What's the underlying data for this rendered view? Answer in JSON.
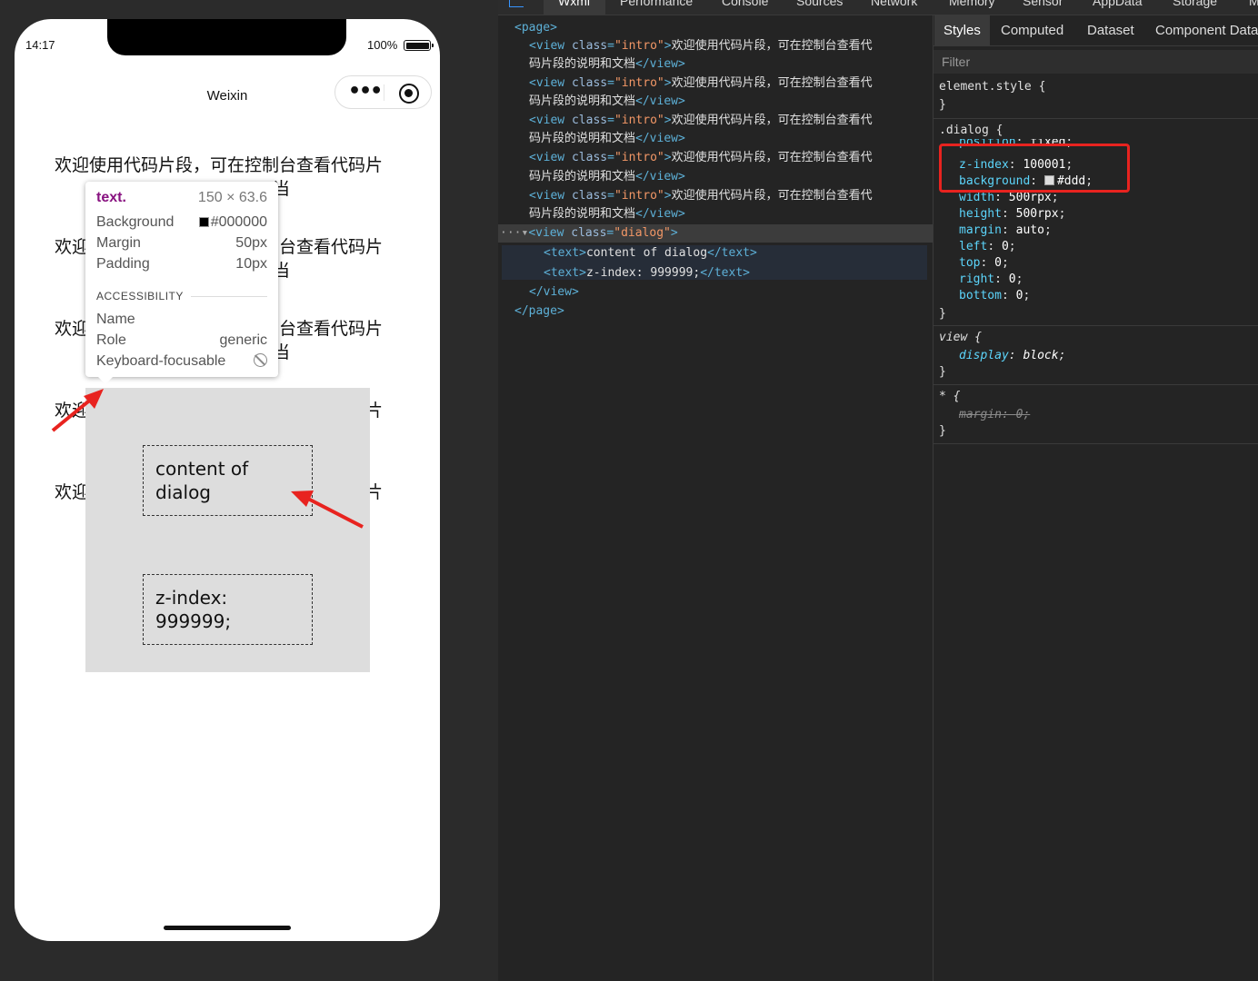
{
  "simulator": {
    "status_time": "14:17",
    "battery_percent": "100%",
    "nav_title": "Weixin",
    "capsule": {
      "more_icon": "more-dots-icon",
      "close_icon": "target-circle-icon"
    },
    "intro_line1": "欢迎使用代码片段，可在控制台查看代码片",
    "intro_line2": "当",
    "intro_line1_short": "欢迎",
    "intro_line1_right": "制台查看代码片",
    "intro_line1_right_b": "码片",
    "dialog": {
      "text1": "content of dialog",
      "text2": "z-index: 999999;"
    },
    "tooltip": {
      "tag": "text.",
      "size": "150 × 63.6",
      "background_label": "Background",
      "background_value": "#000000",
      "margin_label": "Margin",
      "margin_value": "50px",
      "padding_label": "Padding",
      "padding_value": "10px",
      "accessibility_heading": "ACCESSIBILITY",
      "name_label": "Name",
      "role_label": "Role",
      "role_value": "generic",
      "focusable_label": "Keyboard-focusable"
    }
  },
  "devtools": {
    "top_tabs": [
      "Wxml",
      "Performance",
      "Console",
      "Sources",
      "Network",
      "Memory",
      "Sensor",
      "AppData",
      "Storage",
      "M"
    ],
    "active_top_tab": "Wxml",
    "wxml": {
      "page_open": "<page>",
      "intro_open_tag": "<view",
      "intro_attr_name": "class",
      "intro_attr_value": "\"intro\"",
      "intro_text_a": "欢迎使用代码片段，可在控制台查看代",
      "intro_text_b": "码片段的说明和文档",
      "view_close": "</view>",
      "dialog_open_tag": "<view",
      "dialog_attr_name": "class",
      "dialog_attr_value": "\"dialog\"",
      "text_open": "<text>",
      "text_close": "</text>",
      "text1_content": "content of dialog",
      "text2_content": "z-index: 999999;",
      "page_close": "</page>",
      "ellipsis": "···"
    },
    "styles": {
      "tabs": [
        "Styles",
        "Computed",
        "Dataset",
        "Component Data"
      ],
      "active_tab": "Styles",
      "filter_placeholder": "Filter",
      "element_style_selector": "element.style {",
      "close_brace": "}",
      "dialog_selector": ".dialog {",
      "dialog_props": [
        {
          "name": "position",
          "value": "fixed"
        },
        {
          "name": "z-index",
          "value": "100001"
        },
        {
          "name": "background",
          "value": "#ddd"
        },
        {
          "name": "width",
          "value": "500rpx"
        },
        {
          "name": "height",
          "value": "500rpx"
        },
        {
          "name": "margin",
          "value": "auto"
        },
        {
          "name": "left",
          "value": "0"
        },
        {
          "name": "top",
          "value": "0"
        },
        {
          "name": "right",
          "value": "0"
        },
        {
          "name": "bottom",
          "value": "0"
        }
      ],
      "view_selector": "view {",
      "view_prop": {
        "name": "display",
        "value": "block"
      },
      "star_selector": "* {",
      "star_prop": {
        "name": "margin",
        "value": "0"
      }
    }
  },
  "colors": {
    "highlight": "#e8231f",
    "dialog_bg": "#ddd",
    "tag_color": "#5db0d7",
    "attr_value_color": "#f29766"
  }
}
